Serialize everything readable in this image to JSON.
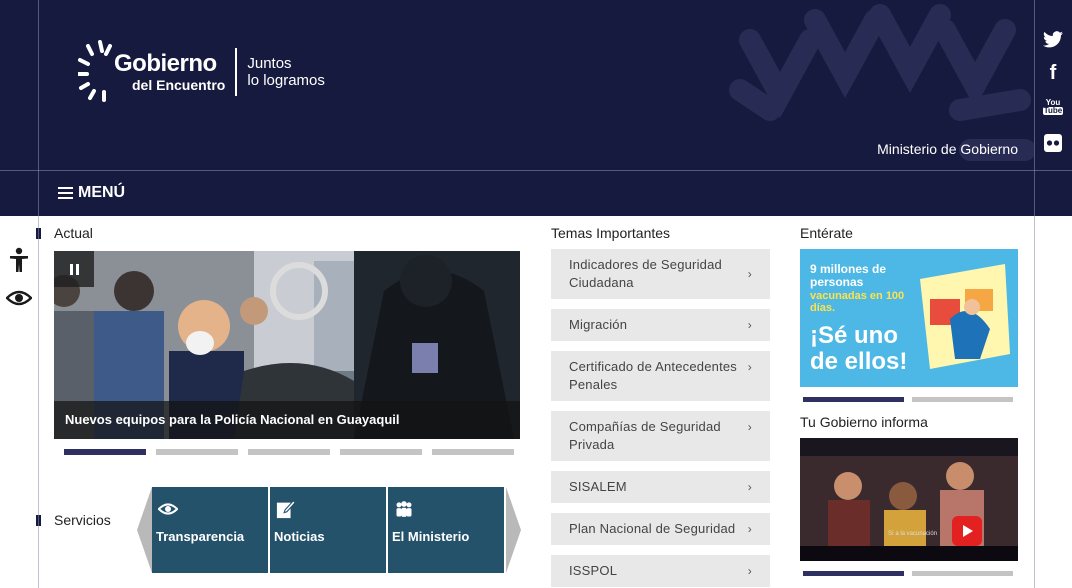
{
  "header": {
    "logo_line1": "Gobierno",
    "logo_line2": "del Encuentro",
    "tagline_line1": "Juntos",
    "tagline_line2": "lo logramos",
    "ministry": "Ministerio de Gobierno",
    "brand_color": "#161a3e"
  },
  "menu": {
    "label": "MENÚ"
  },
  "social": [
    "twitter-icon",
    "facebook-icon",
    "youtube-icon",
    "flickr-icon"
  ],
  "accessibility": [
    "accessibility-person-icon",
    "eye-icon"
  ],
  "actual": {
    "title": "Actual",
    "caption": "Nuevos equipos para la Policía Nacional en Guayaquil",
    "slides": 5,
    "active_slide": 1
  },
  "servicios": {
    "title": "Servicios",
    "items": [
      {
        "label": "Transparencia",
        "icon": "eye-icon"
      },
      {
        "label": "Noticias",
        "icon": "edit-icon"
      },
      {
        "label": "El Ministerio",
        "icon": "people-icon"
      }
    ],
    "tile_color": "#24526b"
  },
  "temas": {
    "title": "Temas Importantes",
    "items": [
      "Indicadores de Seguridad Ciudadana",
      "Migración",
      "Certificado de Antecedentes Penales",
      "Compañías de Seguridad Privada",
      "SISALEM",
      "Plan Nacional de Seguridad",
      "ISSPOL"
    ]
  },
  "enterate": {
    "title": "Entérate",
    "banner_line1": "9 millones de personas",
    "banner_line2": "vacunadas en 100 días.",
    "banner_line3": "¡Sé uno de ellos!",
    "banner_color": "#4db8e5",
    "slides": 2,
    "active_slide": 1
  },
  "tu_gobierno": {
    "title": "Tu Gobierno informa",
    "video_caption": "Sí a la vacunación",
    "slides": 2,
    "active_slide": 1
  }
}
